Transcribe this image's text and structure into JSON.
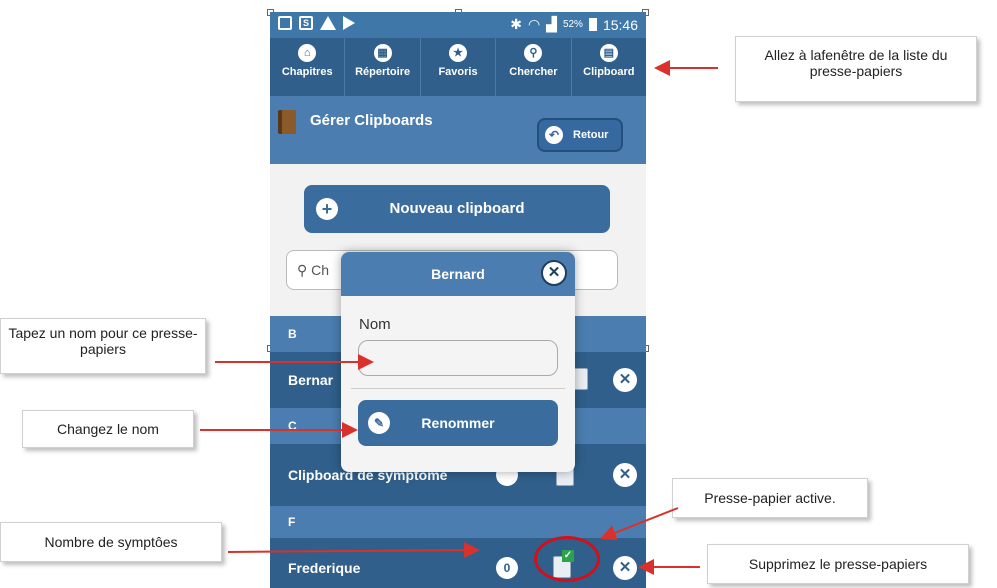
{
  "status_bar": {
    "battery_percent": "52%",
    "time": "15:46"
  },
  "nav": {
    "items": [
      {
        "label": "Chapitres",
        "icon": "home-icon",
        "glyph": "⌂"
      },
      {
        "label": "Répertoire",
        "icon": "grid-icon",
        "glyph": "▦"
      },
      {
        "label": "Favoris",
        "icon": "star-icon",
        "glyph": "★"
      },
      {
        "label": "Chercher",
        "icon": "search-icon",
        "glyph": "⚲"
      },
      {
        "label": "Clipboard",
        "icon": "clipboard-icon",
        "glyph": "▤"
      }
    ]
  },
  "header": {
    "title": "Gérer Clipboards",
    "back_label": "Retour"
  },
  "new_clipboard_label": "Nouveau clipboard",
  "search": {
    "visible_text": "Ch"
  },
  "list": {
    "divider_b": "B",
    "row_bernard": "Bernar",
    "divider_c": "C",
    "row_clipboard": "Clipboard de symptôme",
    "divider_f": "F",
    "row_frederique": "Frederique",
    "frederique_count": "0"
  },
  "modal": {
    "title": "Bernard",
    "field_label": "Nom",
    "field_value": "",
    "rename_label": "Renommer"
  },
  "callouts": {
    "window": "Allez à lafenêtre de la liste du presse-papiers",
    "type_name": "Tapez un nom pour ce presse-papiers",
    "change_name": "Changez le nom",
    "active": "Presse-papier active.",
    "count": "Nombre de symptôes",
    "delete": "Supprimez le presse-papiers"
  },
  "colors": {
    "accent": "#2f5f8a",
    "header": "#4b7db0",
    "arrow": "#d9312b"
  }
}
